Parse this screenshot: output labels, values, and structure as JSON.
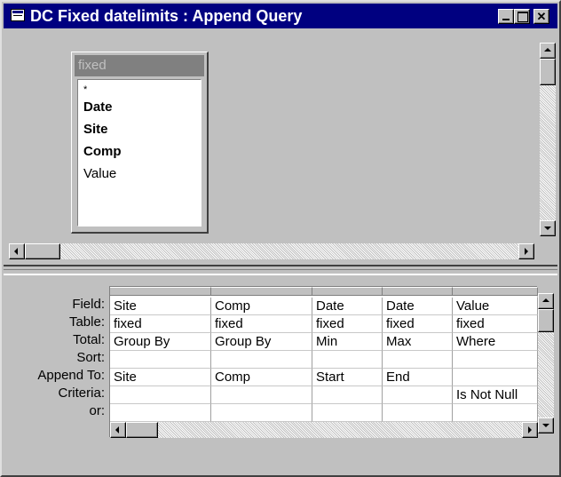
{
  "window": {
    "title": "DC Fixed datelimits : Append Query"
  },
  "field_list": {
    "table_name": "fixed",
    "star": "*",
    "fields": [
      "Date",
      "Site",
      "Comp",
      "Value"
    ],
    "key_fields": [
      "Date",
      "Site",
      "Comp"
    ]
  },
  "grid": {
    "row_labels": [
      "Field:",
      "Table:",
      "Total:",
      "Sort:",
      "Append To:",
      "Criteria:",
      "or:"
    ],
    "columns": [
      {
        "field": "Site",
        "table": "fixed",
        "total": "Group By",
        "sort": "",
        "append_to": "Site",
        "criteria": "",
        "or": ""
      },
      {
        "field": "Comp",
        "table": "fixed",
        "total": "Group By",
        "sort": "",
        "append_to": "Comp",
        "criteria": "",
        "or": ""
      },
      {
        "field": "Date",
        "table": "fixed",
        "total": "Min",
        "sort": "",
        "append_to": "Start",
        "criteria": "",
        "or": ""
      },
      {
        "field": "Date",
        "table": "fixed",
        "total": "Max",
        "sort": "",
        "append_to": "End",
        "criteria": "",
        "or": ""
      },
      {
        "field": "Value",
        "table": "fixed",
        "total": "Where",
        "sort": "",
        "append_to": "",
        "criteria": "Is Not Null",
        "or": ""
      }
    ]
  },
  "icons": {
    "title": "query-window-icon",
    "minimize": "minimize-icon",
    "maximize": "maximize-icon",
    "close": "close-icon"
  },
  "colors": {
    "titlebar": "#000080",
    "face": "#c0c0c0",
    "field_list_title": "#808080"
  }
}
